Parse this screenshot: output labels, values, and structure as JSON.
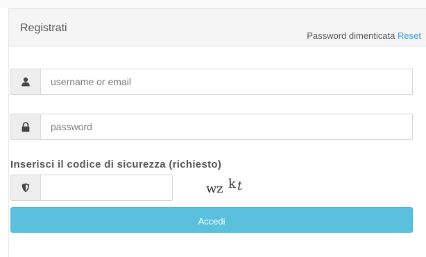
{
  "panel": {
    "title": "Registrati",
    "forgot_text": "Password dimenticata",
    "reset_link": "Reset"
  },
  "form": {
    "username": {
      "placeholder": "username or email",
      "value": "",
      "icon": "user-icon"
    },
    "password": {
      "placeholder": "password",
      "value": "",
      "icon": "lock-icon"
    },
    "security_code": {
      "label": "Inserisci il codice di sicurezza (richiesto)",
      "value": "",
      "icon": "shield-icon",
      "captcha_chars": [
        "w",
        "z",
        "k",
        "t"
      ]
    },
    "submit_label": "Accedi"
  },
  "colors": {
    "accent": "#5bc0de",
    "link": "#3a9cd6",
    "header_bg": "#f5f5f5",
    "addon_bg": "#eeeeee"
  }
}
